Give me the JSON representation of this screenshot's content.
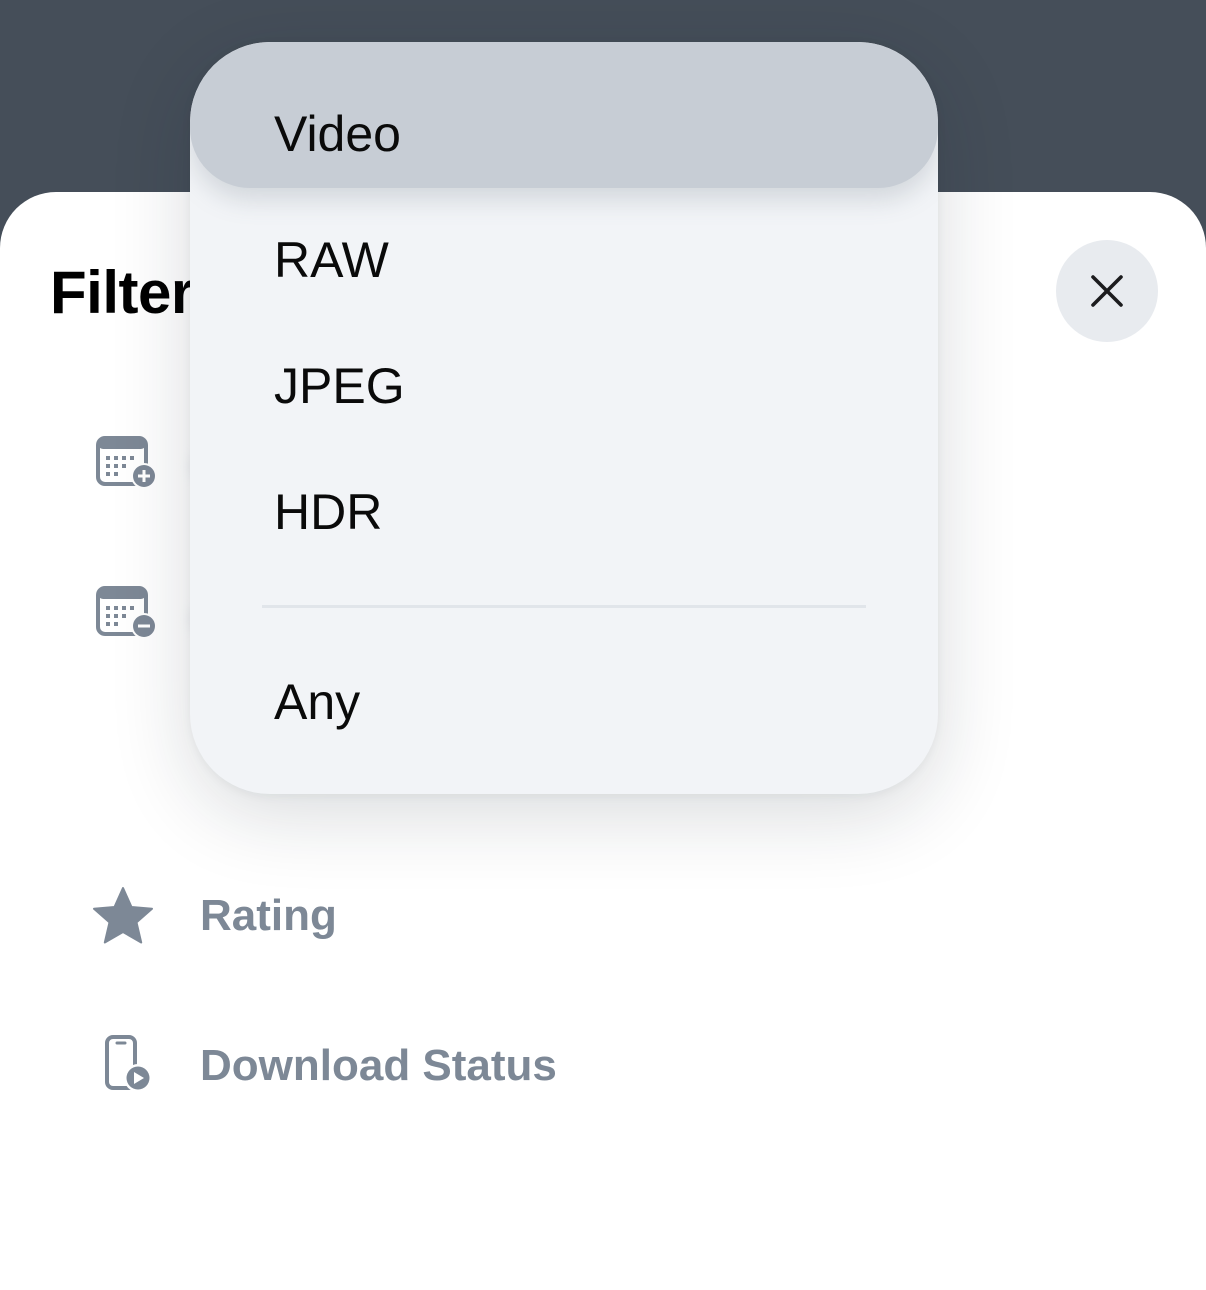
{
  "sheet": {
    "title": "Filter",
    "close_icon": "close-icon"
  },
  "filters": [
    {
      "icon": "calendar-add-icon"
    },
    {
      "icon": "calendar-remove-icon"
    },
    {
      "icon": "star-icon",
      "label": "Rating"
    },
    {
      "icon": "phone-download-icon",
      "label": "Download Status"
    }
  ],
  "menu": {
    "items": [
      {
        "label": "Video",
        "highlighted": true
      },
      {
        "label": "RAW"
      },
      {
        "label": "JPEG"
      },
      {
        "label": "HDR"
      },
      {
        "label": "Any"
      }
    ]
  },
  "colors": {
    "backdrop": "#454e59",
    "sheet": "#ffffff",
    "label_muted": "#7d8896",
    "icon": "#7d8896",
    "menu_bg": "#f2f4f7",
    "menu_highlight": "#c7cdd5"
  }
}
